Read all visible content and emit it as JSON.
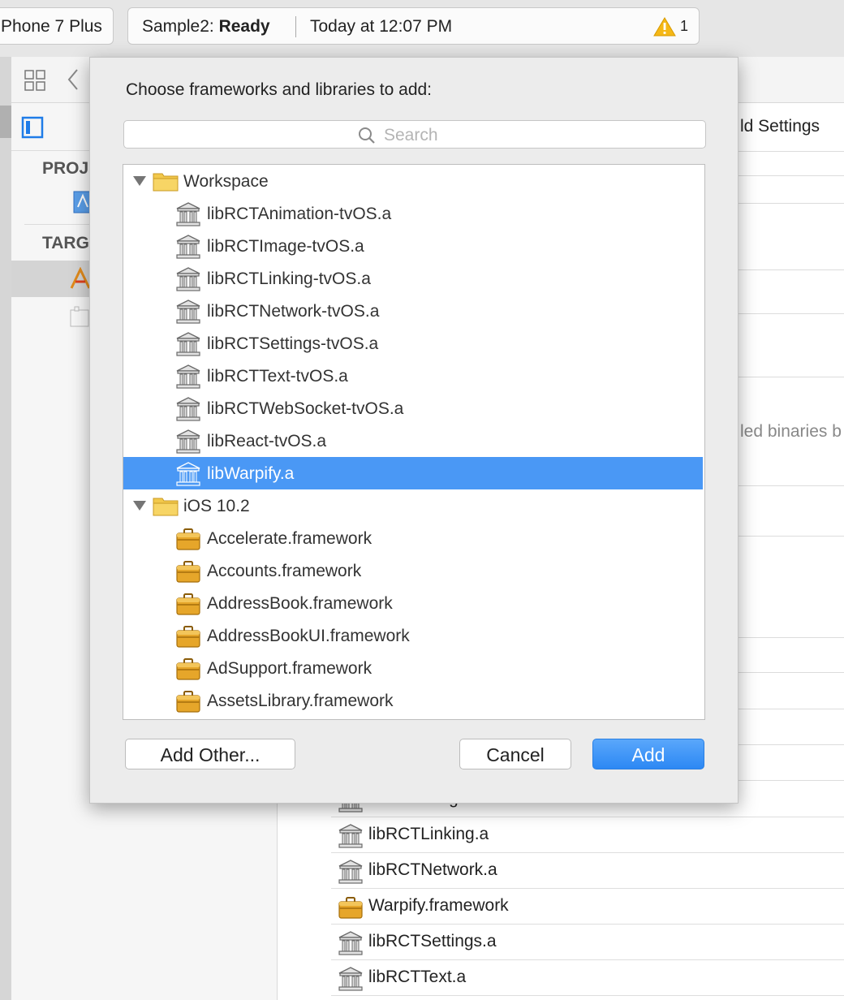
{
  "toolbar": {
    "device": "Phone 7 Plus",
    "project": "Sample2:",
    "status": "Ready",
    "time": "Today at 12:07 PM",
    "warning_count": "1"
  },
  "sidebar": {
    "project_section": "PROJ",
    "targets_section": "TARG"
  },
  "editor": {
    "tab_partial": "ld Settings",
    "partial_text": "led binaries b"
  },
  "background_list": [
    {
      "label": "libRCTImage.a",
      "icon": "library-icon"
    },
    {
      "label": "libRCTLinking.a",
      "icon": "library-icon"
    },
    {
      "label": "libRCTNetwork.a",
      "icon": "library-icon"
    },
    {
      "label": "Warpify.framework",
      "icon": "framework-icon"
    },
    {
      "label": "libRCTSettings.a",
      "icon": "library-icon"
    },
    {
      "label": "libRCTText.a",
      "icon": "library-icon"
    }
  ],
  "dialog": {
    "title": "Choose frameworks and libraries to add:",
    "search_placeholder": "Search",
    "items": [
      {
        "type": "group",
        "label": "Workspace"
      },
      {
        "type": "library",
        "label": "libRCTAnimation-tvOS.a"
      },
      {
        "type": "library",
        "label": "libRCTImage-tvOS.a"
      },
      {
        "type": "library",
        "label": "libRCTLinking-tvOS.a"
      },
      {
        "type": "library",
        "label": "libRCTNetwork-tvOS.a"
      },
      {
        "type": "library",
        "label": "libRCTSettings-tvOS.a"
      },
      {
        "type": "library",
        "label": "libRCTText-tvOS.a"
      },
      {
        "type": "library",
        "label": "libRCTWebSocket-tvOS.a"
      },
      {
        "type": "library",
        "label": "libReact-tvOS.a"
      },
      {
        "type": "library",
        "label": "libWarpify.a",
        "selected": true
      },
      {
        "type": "group",
        "label": "iOS 10.2"
      },
      {
        "type": "framework",
        "label": "Accelerate.framework"
      },
      {
        "type": "framework",
        "label": "Accounts.framework"
      },
      {
        "type": "framework",
        "label": "AddressBook.framework"
      },
      {
        "type": "framework",
        "label": "AddressBookUI.framework"
      },
      {
        "type": "framework",
        "label": "AdSupport.framework"
      },
      {
        "type": "framework",
        "label": "AssetsLibrary.framework"
      }
    ],
    "add_other_label": "Add Other...",
    "cancel_label": "Cancel",
    "add_label": "Add"
  },
  "colors": {
    "selection": "#4a98f5",
    "accent_button": "#2c88f4",
    "folder": "#f2c84b",
    "framework": "#e0a020"
  }
}
